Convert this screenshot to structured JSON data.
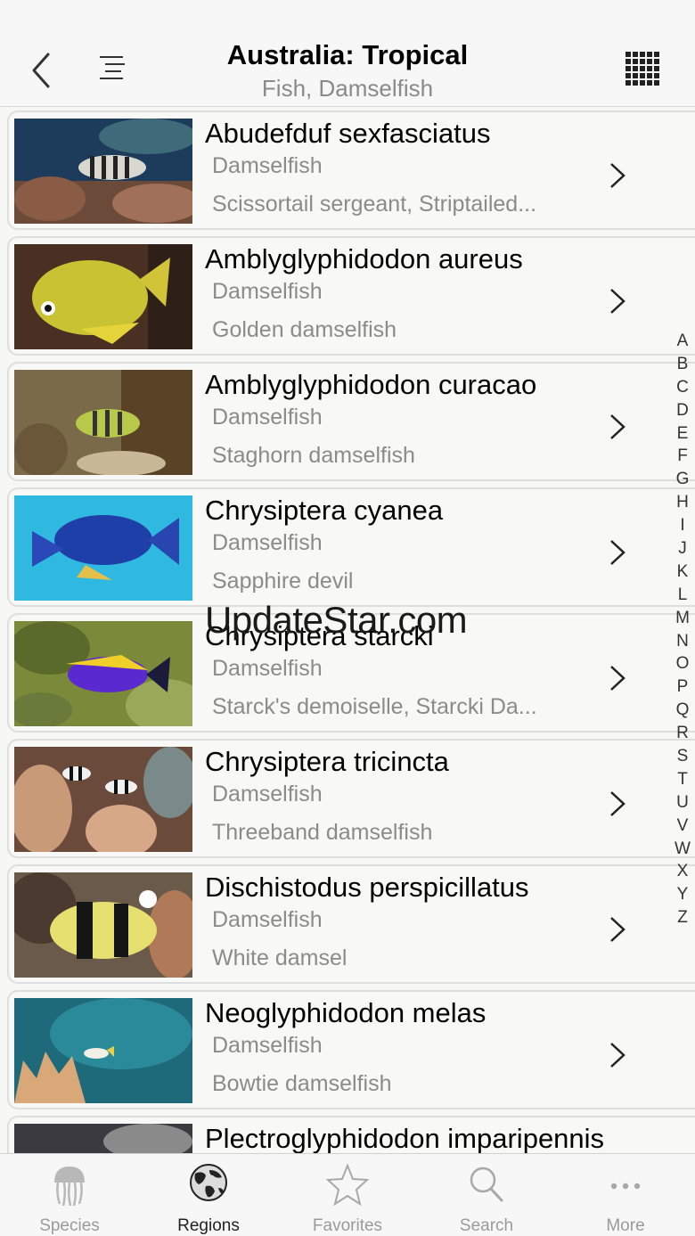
{
  "nav": {
    "title": "Australia: Tropical",
    "subtitle": "Fish, Damselfish",
    "icons": [
      "back-chevron-icon",
      "outline-list-icon",
      "grid-view-icon"
    ]
  },
  "items": [
    {
      "scientific": "Abudefduf sexfasciatus",
      "family": "Damselfish",
      "common": "Scissortail sergeant, Striptailed..."
    },
    {
      "scientific": "Amblyglyphidodon aureus",
      "family": "Damselfish",
      "common": "Golden damselfish"
    },
    {
      "scientific": "Amblyglyphidodon curacao",
      "family": "Damselfish",
      "common": "Staghorn damselfish"
    },
    {
      "scientific": "Chrysiptera cyanea",
      "family": "Damselfish",
      "common": "Sapphire devil"
    },
    {
      "scientific": "Chrysiptera starcki",
      "family": "Damselfish",
      "common": "Starck's demoiselle, Starcki Da..."
    },
    {
      "scientific": "Chrysiptera tricincta",
      "family": "Damselfish",
      "common": "Threeband damselfish"
    },
    {
      "scientific": "Dischistodus perspicillatus",
      "family": "Damselfish",
      "common": "White damsel"
    },
    {
      "scientific": "Neoglyphidodon melas",
      "family": "Damselfish",
      "common": "Bowtie damselfish"
    },
    {
      "scientific": "Plectroglyphidodon imparipennis",
      "family": "",
      "common": ""
    }
  ],
  "alphabet": [
    "A",
    "B",
    "C",
    "D",
    "E",
    "F",
    "G",
    "H",
    "I",
    "J",
    "K",
    "L",
    "M",
    "N",
    "O",
    "P",
    "Q",
    "R",
    "S",
    "T",
    "U",
    "V",
    "W",
    "X",
    "Y",
    "Z"
  ],
  "watermark": "UpdateStar.com",
  "tabs": [
    {
      "label": "Species",
      "icon": "jellyfish-icon",
      "active": false
    },
    {
      "label": "Regions",
      "icon": "globe-icon",
      "active": true
    },
    {
      "label": "Favorites",
      "icon": "star-icon",
      "active": false
    },
    {
      "label": "Search",
      "icon": "magnifier-icon",
      "active": false
    },
    {
      "label": "More",
      "icon": "ellipsis-icon",
      "active": false
    }
  ],
  "colors": {
    "accent": "#8b8b8b",
    "active_tab": "#222222",
    "inactive_tab": "#9a9a9a"
  }
}
